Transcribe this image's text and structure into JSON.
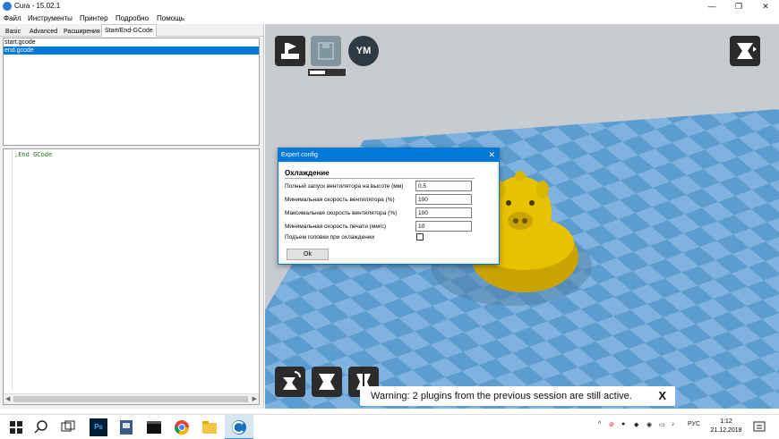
{
  "window": {
    "title": "Cura - 15.02.1",
    "minimize": "—",
    "maximize": "❐",
    "close": "✕"
  },
  "menu": [
    "Файл",
    "Инструменты",
    "Принтер",
    "Подробно",
    "Помощь"
  ],
  "tabs": [
    "Basic",
    "Advanced",
    "Расширения",
    "Start/End-GCode"
  ],
  "active_tab": "Start/End-GCode",
  "files": [
    "start.gcode",
    "end.gcode"
  ],
  "selected_file": "end.gcode",
  "editor": {
    "code": ";End GCode"
  },
  "viewport": {
    "toolbar_icons": [
      "load-model-icon",
      "save-toolpath-icon",
      "youmagine-icon"
    ],
    "ym_label": "YM",
    "view_mode_icon": "view-mode-icon",
    "progress": 0.45,
    "bottom_tools": [
      "rotate-icon",
      "scale-icon",
      "mirror-icon"
    ],
    "warning": "Warning: 2 plugins from the previous session are still active.",
    "warning_close": "X",
    "colors": {
      "floor_light": "#7fb2de",
      "floor_dark": "#5d9ccf",
      "model": "#e6c200",
      "background": "#c8cbd0"
    }
  },
  "dialog": {
    "title": "Expert config",
    "close": "✕",
    "section": "Охлаждение",
    "fields": [
      {
        "label": "Полный запуск вентилятора на высоте (мм)",
        "value": "0.5"
      },
      {
        "label": "Минимальная скорость вентилятора (%)",
        "value": "100"
      },
      {
        "label": "Максимальная скорость вентилятора (%)",
        "value": "100"
      },
      {
        "label": "Минимальная скорость печати (мм/с)",
        "value": "10"
      }
    ],
    "checkbox_label": "Подъем головки при охлаждении",
    "checkbox_checked": false,
    "ok": "Ok"
  },
  "taskbar": {
    "icons": [
      "windows-start-icon",
      "search-icon",
      "task-view-icon",
      "photoshop-icon",
      "app-icon",
      "terminal-icon",
      "chrome-icon",
      "file-explorer-icon",
      "cura-icon"
    ],
    "ps_label": "Ps",
    "language": "РУС",
    "time": "1:12",
    "date": "21.12.2018"
  }
}
